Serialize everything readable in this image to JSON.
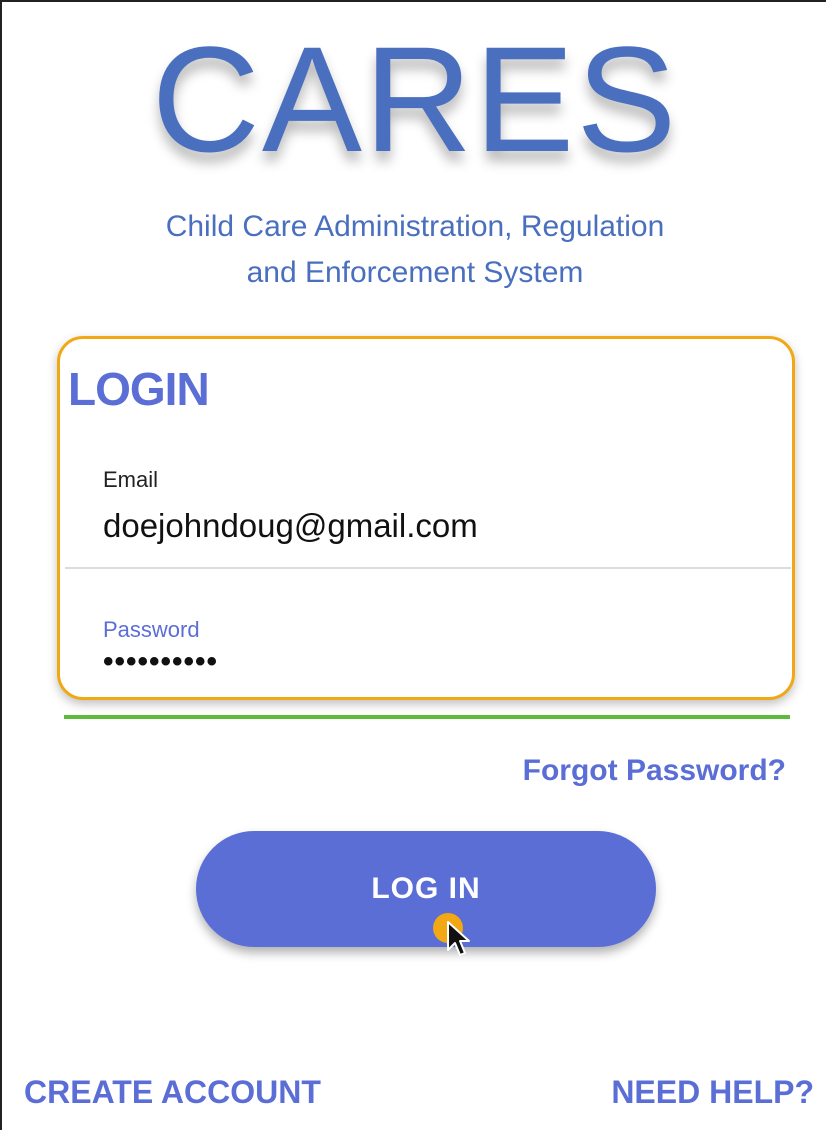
{
  "app": {
    "logo_text": "CARES",
    "subtitle_line1": "Child Care Administration, Regulation",
    "subtitle_line2": "and Enforcement System"
  },
  "login": {
    "title": "LOGIN",
    "email_label": "Email",
    "email_value": "doejohndoug@gmail.com",
    "password_label": "Password",
    "password_value": "••••••••••",
    "forgot_label": "Forgot Password?",
    "login_button_label": "LOG IN"
  },
  "footer": {
    "create_account_label": "CREATE ACCOUNT",
    "need_help_label": "NEED HELP?"
  },
  "colors": {
    "brand_blue": "#4a6fbf",
    "accent_purple": "#5b6ed6",
    "focus_orange": "#f2a814",
    "valid_green": "#5cba3c"
  },
  "icons": {
    "pointer": "mouse-pointer-icon",
    "click_indicator": "click-indicator-icon"
  }
}
